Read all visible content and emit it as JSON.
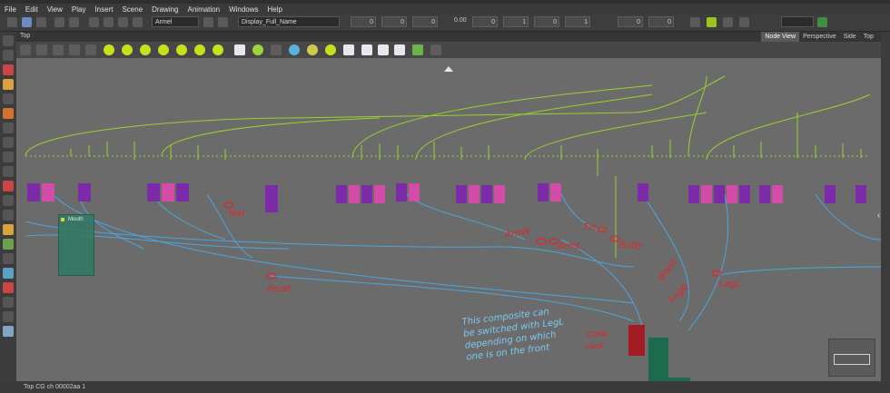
{
  "menu": [
    "File",
    "Edit",
    "View",
    "Play",
    "Insert",
    "Scene",
    "Drawing",
    "Animation",
    "Windows",
    "Help"
  ],
  "toolbar": {
    "drawing_select": "Armel",
    "display_select": "Display_Full_Name",
    "value_readout": "0.00",
    "num_fields": [
      "0",
      "0",
      "0",
      "0",
      "1",
      "0",
      "1",
      "0",
      "0"
    ]
  },
  "view": {
    "top_label": "Top",
    "tabs": [
      "Node View",
      "Perspective",
      "Side",
      "Top"
    ],
    "active_tab": "Node View"
  },
  "node_mouth_label": "Mouth",
  "annotations": {
    "hat": "Hat",
    "head": "Head",
    "armr": "ArmR",
    "arml": "ArmL",
    "tie": "Tie",
    "body": "Body",
    "waist": "Waist",
    "legr": "LegR",
    "legl": "LegL",
    "comp_side": [
      "COMR",
      "LegR"
    ],
    "composite_note": [
      "This composite can",
      "be switched with LegL",
      "depending on which",
      "one is on the front"
    ]
  },
  "status": "Top  CG  ch  00002aa  1",
  "colors": {
    "wire_green": "#9bd12d",
    "wire_blue": "#4aa6df",
    "node_purple": "#7b2aa8",
    "node_pink": "#d24ca8",
    "annot_red": "#e0262a"
  }
}
